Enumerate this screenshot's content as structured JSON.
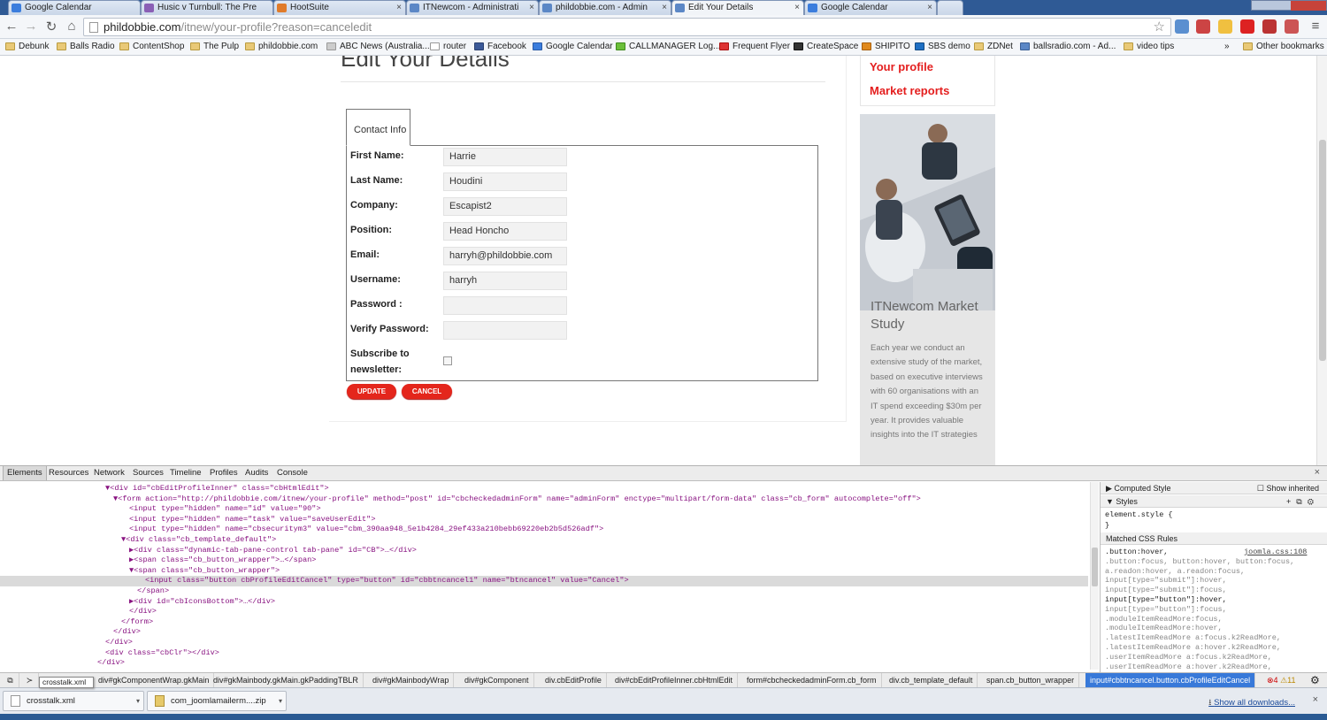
{
  "tabs": [
    {
      "label": "Google Calendar",
      "fav": "#3b7ddd"
    },
    {
      "label": "Husic v Turnbull: The Pre",
      "fav": "#8a5fb5"
    },
    {
      "label": "HootSuite",
      "fav": "#e07b2a"
    },
    {
      "label": "ITNewcom - Administrati",
      "fav": "#5b87c6"
    },
    {
      "label": "phildobbie.com - Admin",
      "fav": "#5b87c6"
    },
    {
      "label": "Edit Your Details",
      "fav": "#5b87c6"
    },
    {
      "label": "Google Calendar",
      "fav": "#3b7ddd"
    }
  ],
  "address": {
    "host": "phildobbie.com",
    "path": "/itnew/your-profile?reason=canceledit"
  },
  "bookmarks": [
    "Debunk",
    "Balls Radio",
    "ContentShop",
    "The Pulp",
    "phildobbie.com",
    "ABC News (Australia...",
    "router",
    "Facebook",
    "Google Calendar",
    "CALLMANAGER Log...",
    "Frequent Flyer",
    "CreateSpace",
    "SHIPITO",
    "SBS demo",
    "ZDNet",
    "ballsradio.com - Ad...",
    "video tips",
    "Other bookmarks"
  ],
  "bookmarks_more": "»",
  "page": {
    "heading": "Edit Your Details",
    "tab_label": "Contact Info",
    "fields": [
      {
        "label": "First Name:",
        "value": "Harrie"
      },
      {
        "label": "Last Name:",
        "value": "Houdini"
      },
      {
        "label": "Company:",
        "value": "Escapist2"
      },
      {
        "label": "Position:",
        "value": "Head Honcho"
      },
      {
        "label": "Email:",
        "value": "harryh@phildobbie.com"
      },
      {
        "label": "Username:",
        "value": "harryh"
      },
      {
        "label": "Password :",
        "value": ""
      },
      {
        "label": "Verify Password:",
        "value": ""
      }
    ],
    "subscribe_label_1": "Subscribe to",
    "subscribe_label_2": "newsletter:",
    "update_label": "UPDATE",
    "cancel_label": "CANCEL",
    "sidebar_links": [
      "Your profile",
      "Market reports"
    ],
    "ad_title": "ITNewcom Market Study",
    "ad_text": "Each year we conduct an extensive study of the market, based on executive interviews with 60 organisations with an IT spend exceeding $30m per year. It provides valuable insights into the IT strategies"
  },
  "devtools": {
    "tabs": [
      "Elements",
      "Resources",
      "Network",
      "Sources",
      "Timeline",
      "Profiles",
      "Audits",
      "Console"
    ],
    "close": "×",
    "code_lines": [
      "▼<div id=\"cbEditProfileInner\" class=\"cbHtmlEdit\">",
      "▼<form action=\"http://phildobbie.com/itnew/your-profile\" method=\"post\" id=\"cbcheckedadminForm\" name=\"adminForm\" enctype=\"multipart/form-data\" class=\"cb_form\" autocomplete=\"off\">",
      "<input type=\"hidden\" name=\"id\" value=\"90\">",
      "<input type=\"hidden\" name=\"task\" value=\"saveUserEdit\">",
      "<input type=\"hidden\" name=\"cbsecuritym3\" value=\"cbm_390aa948_5e1b4284_29ef433a210bebb69220eb2b5d526adf\">",
      "▼<div class=\"cb_template_default\">",
      "▶<div class=\"dynamic-tab-pane-control tab-pane\" id=\"CB\">…</div>",
      "▶<span class=\"cb_button_wrapper\">…</span>",
      "▼<span class=\"cb_button_wrapper\">",
      "<input class=\"button cbProfileEditCancel\" type=\"button\" id=\"cbbtncancel1\" name=\"btncancel\" value=\"Cancel\">",
      "</span>",
      "▶<div id=\"cbIconsBottom\">…</div>",
      "</div>",
      "</form>",
      "</div>",
      "</div>",
      "<div class=\"cbClr\"></div>",
      "</div>"
    ],
    "computed_style": "Computed Style",
    "show_inherited": "Show inherited",
    "styles": "Styles",
    "element_style": "element.style {",
    "element_style_close": "}",
    "matched_rules": "Matched CSS Rules",
    "rule_source": "joomla.css:108",
    "selectors": [
      ".button:hover,",
      ".button:focus, button:hover, button:focus,",
      "a.readon:hover, a.readon:focus,",
      "input[type=\"submit\"]:hover,",
      "input[type=\"submit\"]:focus,",
      "input[type=\"button\"]:hover,",
      "input[type=\"button\"]:focus,",
      ".moduleItemReadMore:focus,",
      ".moduleItemReadMore:hover,",
      ".latestItemReadMore a:focus.k2ReadMore,",
      ".latestItemReadMore a:hover.k2ReadMore,",
      ".userItemReadMore a:focus.k2ReadMore,",
      ".userItemReadMore a:hover.k2ReadMore,"
    ],
    "crumbs": [
      "div#gkComponentWrap.gkMain",
      "div#gkMainbody.gkMain.gkPaddingTBLR",
      "div#gkMainbodyWrap",
      "div#gkComponent",
      "div.cbEditProfile",
      "div#cbEditProfileInner.cbHtmlEdit",
      "form#cbcheckedadminForm.cb_form",
      "div.cb_template_default",
      "span.cb_button_wrapper",
      "input#cbbtncancel.button.cbProfileEditCancel"
    ],
    "errors": "4",
    "warnings": "11",
    "tooltip": "crosstalk.xml"
  },
  "downloads": {
    "items": [
      "crosstalk.xml",
      "com_joomlamailerm....zip"
    ],
    "show_all": "Show all downloads...",
    "close": "×"
  },
  "colors": {
    "accent_red": "#e41e1e",
    "selection_blue": "#3879d9"
  }
}
